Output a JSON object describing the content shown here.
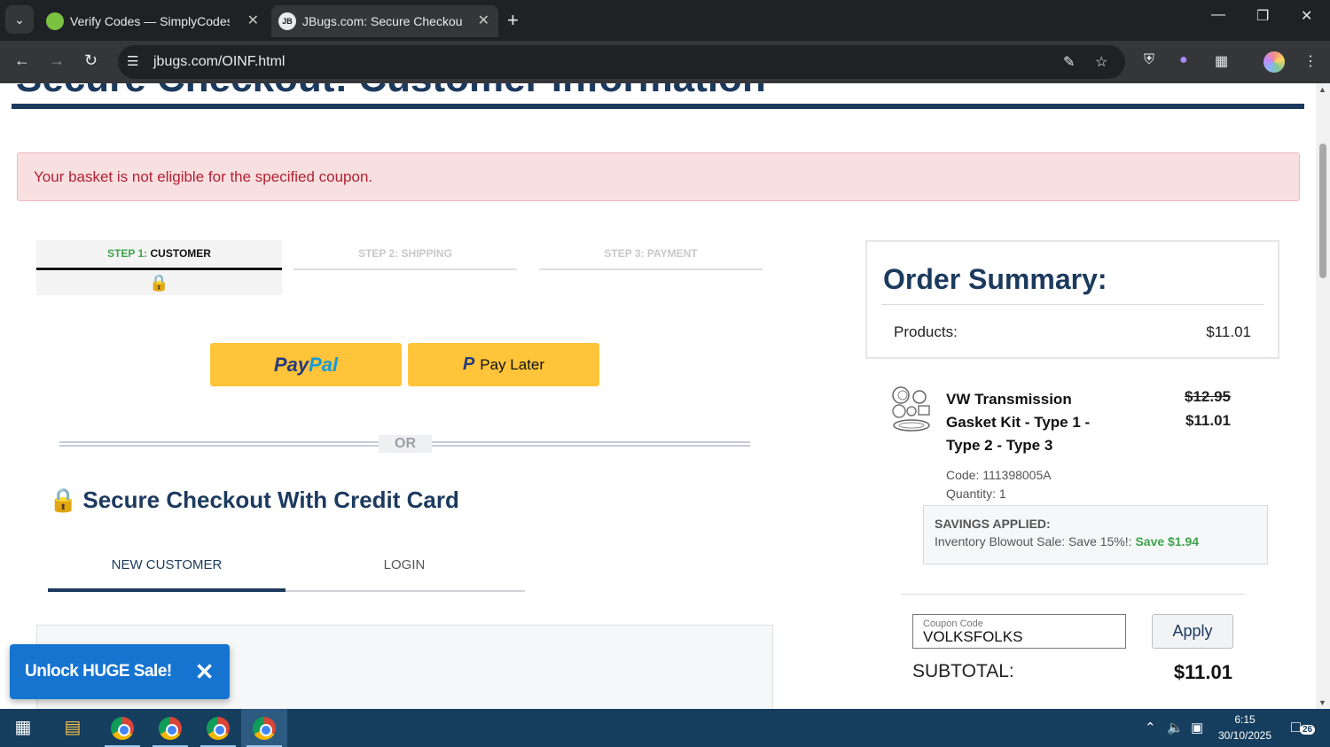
{
  "browser": {
    "tabs": [
      {
        "title": "Verify Codes — SimplyCodes",
        "favicon": "simplycodes-icon"
      },
      {
        "title": "JBugs.com: Secure Checkout: C",
        "favicon": "jb-icon",
        "favicon_text": "JB"
      }
    ],
    "url": "jbugs.com/OINF.html"
  },
  "page": {
    "heading": "Secure Checkout: Customer Information",
    "alert": "Your basket is not eligible for the specified coupon.",
    "steps": [
      {
        "num": "STEP 1:",
        "label": "CUSTOMER"
      },
      {
        "label": "STEP 2: SHIPPING"
      },
      {
        "label": "STEP 3: PAYMENT"
      }
    ],
    "paypal": {
      "part1": "Pay",
      "part2": "Pal"
    },
    "pay_later": {
      "icon": "P",
      "label": "Pay Later"
    },
    "or_text": "OR",
    "cc_heading": "Secure Checkout With Credit Card",
    "customer_tabs": {
      "new": "NEW CUSTOMER",
      "login": "LOGIN"
    },
    "promo": {
      "label": "Unlock HUGE Sale!"
    }
  },
  "summary": {
    "title": "Order Summary:",
    "products_label": "Products:",
    "products_value": "$11.01",
    "item": {
      "name": "VW Transmission Gasket Kit - Type 1 - Type 2 - Type 3",
      "old_price": "$12.95",
      "new_price": "$11.01",
      "code": "Code: 111398005A",
      "quantity": "Quantity: 1"
    },
    "savings": {
      "title": "SAVINGS APPLIED:",
      "line": "Inventory Blowout Sale: Save 15%!: ",
      "save": "Save $1.94"
    },
    "coupon": {
      "placeholder": "Coupon Code",
      "value": "VOLKSFOLKS"
    },
    "apply_label": "Apply",
    "subtotal_label": "SUBTOTAL:",
    "subtotal_value": "$11.01"
  },
  "taskbar": {
    "time": "6:15",
    "date": "30/10/2025",
    "notifications": "26"
  },
  "colors": {
    "brand_navy": "#1c3a5e",
    "alert_text": "#b22234",
    "paypal_yellow": "#ffc439",
    "savings_green": "#3fa34d",
    "promo_blue": "#1674d1"
  }
}
